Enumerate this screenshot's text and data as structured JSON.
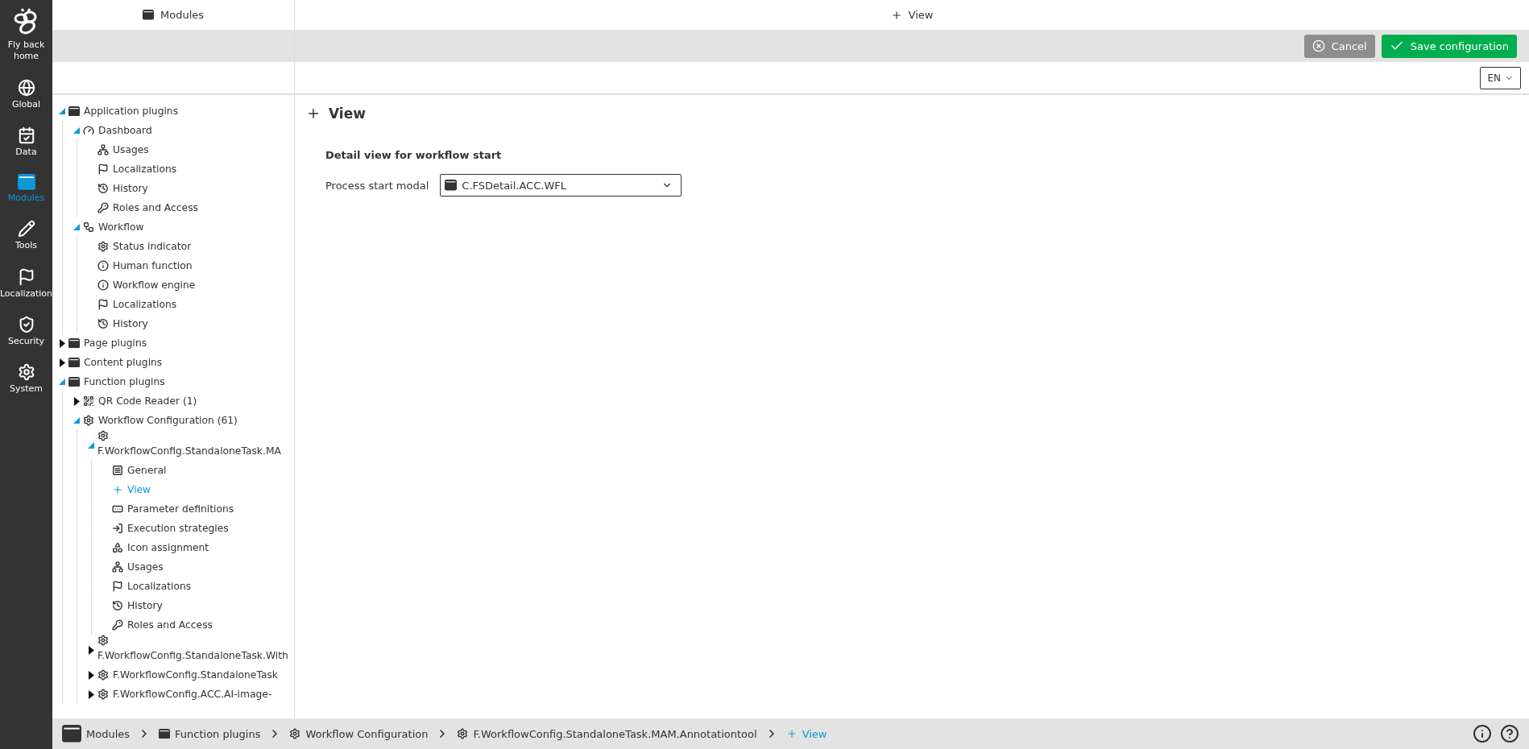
{
  "sidebar": {
    "home_label": "Fly back home",
    "items": [
      {
        "label": "Global",
        "selected": false
      },
      {
        "label": "Data",
        "selected": false
      },
      {
        "label": "Modules",
        "selected": true
      },
      {
        "label": "Tools",
        "selected": false
      },
      {
        "label": "Localization",
        "selected": false
      },
      {
        "label": "Security",
        "selected": false
      },
      {
        "label": "System",
        "selected": false
      }
    ]
  },
  "left_header": {
    "title": "Modules"
  },
  "right_header": {
    "title": "View"
  },
  "actions": {
    "cancel": "Cancel",
    "save": "Save configuration"
  },
  "language": "EN",
  "tree": [
    {
      "label": "Application plugins",
      "kind": "window",
      "expanded": true,
      "selected": false,
      "children": [
        {
          "label": "Dashboard",
          "kind": "dashboard",
          "expanded": true,
          "selected": false,
          "children": [
            {
              "label": "Usages",
              "kind": "usages",
              "selected": false
            },
            {
              "label": "Localizations",
              "kind": "flag",
              "selected": false
            },
            {
              "label": "History",
              "kind": "history",
              "selected": false
            },
            {
              "label": "Roles and Access",
              "kind": "key",
              "selected": false
            }
          ]
        },
        {
          "label": "Workflow",
          "kind": "workflow",
          "expanded": true,
          "selected": false,
          "children": [
            {
              "label": "Status indicator",
              "kind": "gear",
              "selected": false
            },
            {
              "label": "Human function",
              "kind": "info",
              "selected": false
            },
            {
              "label": "Workflow engine",
              "kind": "info",
              "selected": false
            },
            {
              "label": "Localizations",
              "kind": "flag",
              "selected": false
            },
            {
              "label": "History",
              "kind": "history",
              "selected": false
            }
          ]
        }
      ]
    },
    {
      "label": "Page plugins",
      "kind": "window",
      "expanded": false,
      "selected": false
    },
    {
      "label": "Content plugins",
      "kind": "window",
      "expanded": false,
      "selected": false
    },
    {
      "label": "Function plugins",
      "kind": "window",
      "expanded": true,
      "selected": false,
      "children": [
        {
          "label": "QR Code Reader (1)",
          "kind": "qr",
          "expanded": false,
          "selected": false
        },
        {
          "label": "Workflow Configuration (61)",
          "kind": "gear",
          "expanded": true,
          "selected": false,
          "children": [
            {
              "label": "F.WorkflowConfig.StandaloneTask.MA",
              "kind": "gear",
              "expanded": true,
              "selected": false,
              "children": [
                {
                  "label": "General",
                  "kind": "general",
                  "selected": false
                },
                {
                  "label": "View",
                  "kind": "plus",
                  "selected": true
                },
                {
                  "label": "Parameter definitions",
                  "kind": "parameters",
                  "selected": false
                },
                {
                  "label": "Execution strategies",
                  "kind": "execution",
                  "selected": false
                },
                {
                  "label": "Icon assignment",
                  "kind": "icons",
                  "selected": false
                },
                {
                  "label": "Usages",
                  "kind": "usages",
                  "selected": false
                },
                {
                  "label": "Localizations",
                  "kind": "flag",
                  "selected": false
                },
                {
                  "label": "History",
                  "kind": "history",
                  "selected": false
                },
                {
                  "label": "Roles and Access",
                  "kind": "key",
                  "selected": false
                }
              ]
            },
            {
              "label": "F.WorkflowConfig.StandaloneTask.With",
              "kind": "gear",
              "expanded": false,
              "selected": false
            },
            {
              "label": "F.WorkflowConfig.StandaloneTask",
              "kind": "gear",
              "expanded": false,
              "selected": false
            },
            {
              "label": "F.WorkflowConfig.ACC.AI-image-",
              "kind": "gear",
              "expanded": false,
              "selected": false
            }
          ]
        }
      ]
    }
  ],
  "content": {
    "title": "View",
    "section": "Detail view for workflow start",
    "field": {
      "label": "Process start modal",
      "value": "C.FSDetail.ACC.WFL"
    }
  },
  "breadcrumb": [
    {
      "label": "Modules",
      "kind": "home",
      "selected": false
    },
    {
      "label": "Function plugins",
      "kind": "window",
      "selected": false
    },
    {
      "label": "Workflow Configuration",
      "kind": "gear",
      "selected": false
    },
    {
      "label": "F.WorkflowConfig.StandaloneTask.MAM.Annotationtool",
      "kind": "gear",
      "selected": false
    },
    {
      "label": "View",
      "kind": "plus",
      "selected": true
    }
  ]
}
